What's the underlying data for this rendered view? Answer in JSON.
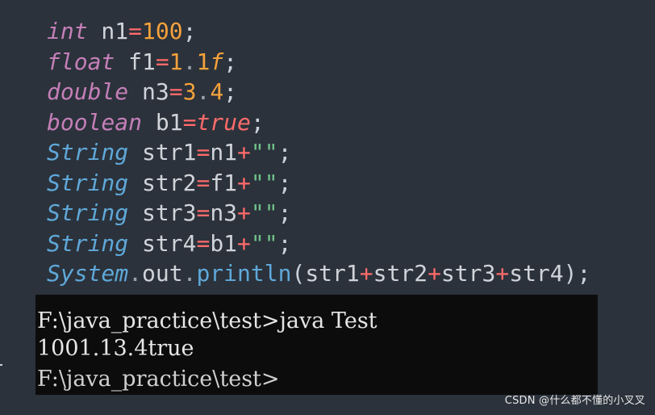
{
  "code": {
    "lines": [
      [
        {
          "t": "int",
          "c": "keyword"
        },
        {
          "t": " n1",
          "c": "ident"
        },
        {
          "t": "=",
          "c": "op"
        },
        {
          "t": "100",
          "c": "num"
        },
        {
          "t": ";",
          "c": "punct"
        }
      ],
      [
        {
          "t": "float",
          "c": "keyword"
        },
        {
          "t": " f1",
          "c": "ident"
        },
        {
          "t": "=",
          "c": "op"
        },
        {
          "t": "1",
          "c": "num"
        },
        {
          "t": ".",
          "c": "dot"
        },
        {
          "t": "1",
          "c": "num"
        },
        {
          "t": "f",
          "c": "suffix"
        },
        {
          "t": ";",
          "c": "punct"
        }
      ],
      [
        {
          "t": "double",
          "c": "keyword"
        },
        {
          "t": " n3",
          "c": "ident"
        },
        {
          "t": "=",
          "c": "op"
        },
        {
          "t": "3",
          "c": "num"
        },
        {
          "t": ".",
          "c": "dot"
        },
        {
          "t": "4",
          "c": "num"
        },
        {
          "t": ";",
          "c": "punct"
        }
      ],
      [
        {
          "t": "boolean",
          "c": "keyword"
        },
        {
          "t": " b1",
          "c": "ident"
        },
        {
          "t": "=",
          "c": "op"
        },
        {
          "t": "true",
          "c": "bool"
        },
        {
          "t": ";",
          "c": "punct"
        }
      ],
      [
        {
          "t": "String",
          "c": "type"
        },
        {
          "t": " str1",
          "c": "ident"
        },
        {
          "t": "=",
          "c": "op"
        },
        {
          "t": "n1",
          "c": "ident"
        },
        {
          "t": "+",
          "c": "op"
        },
        {
          "t": "\"\"",
          "c": "string"
        },
        {
          "t": ";",
          "c": "punct"
        }
      ],
      [
        {
          "t": "String",
          "c": "type"
        },
        {
          "t": " str2",
          "c": "ident"
        },
        {
          "t": "=",
          "c": "op"
        },
        {
          "t": "f1",
          "c": "ident"
        },
        {
          "t": "+",
          "c": "op"
        },
        {
          "t": "\"\"",
          "c": "string"
        },
        {
          "t": ";",
          "c": "punct"
        }
      ],
      [
        {
          "t": "String",
          "c": "type"
        },
        {
          "t": " str3",
          "c": "ident"
        },
        {
          "t": "=",
          "c": "op"
        },
        {
          "t": "n3",
          "c": "ident"
        },
        {
          "t": "+",
          "c": "op"
        },
        {
          "t": "\"\"",
          "c": "string"
        },
        {
          "t": ";",
          "c": "punct"
        }
      ],
      [
        {
          "t": "String",
          "c": "type"
        },
        {
          "t": " str4",
          "c": "ident"
        },
        {
          "t": "=",
          "c": "op"
        },
        {
          "t": "b1",
          "c": "ident"
        },
        {
          "t": "+",
          "c": "op"
        },
        {
          "t": "\"\"",
          "c": "string"
        },
        {
          "t": ";",
          "c": "punct"
        }
      ],
      [
        {
          "t": "System",
          "c": "type"
        },
        {
          "t": ".",
          "c": "dot"
        },
        {
          "t": "out",
          "c": "member"
        },
        {
          "t": ".",
          "c": "dot"
        },
        {
          "t": "println",
          "c": "method"
        },
        {
          "t": "(",
          "c": "punct"
        },
        {
          "t": "str1",
          "c": "ident"
        },
        {
          "t": "+",
          "c": "op"
        },
        {
          "t": "str2",
          "c": "ident"
        },
        {
          "t": "+",
          "c": "op"
        },
        {
          "t": "str3",
          "c": "ident"
        },
        {
          "t": "+",
          "c": "op"
        },
        {
          "t": "str4",
          "c": "ident"
        },
        {
          "t": ");",
          "c": "punct"
        }
      ]
    ]
  },
  "console": {
    "command_line": "F:\\java_practice\\test>java Test",
    "output_line": "1001.13.4true",
    "partial_prompt": "F:\\java_practice\\test>"
  },
  "watermark": {
    "text": "CSDN @什么都不懂的小叉叉"
  },
  "colors": {
    "editor_bg": "#2b323b",
    "console_bg": "#0c0c0c",
    "keyword": "#c57fb8",
    "type": "#5fa8d9",
    "operator": "#ff6b6b",
    "number": "#f6a23b",
    "string": "#6fc18a"
  }
}
